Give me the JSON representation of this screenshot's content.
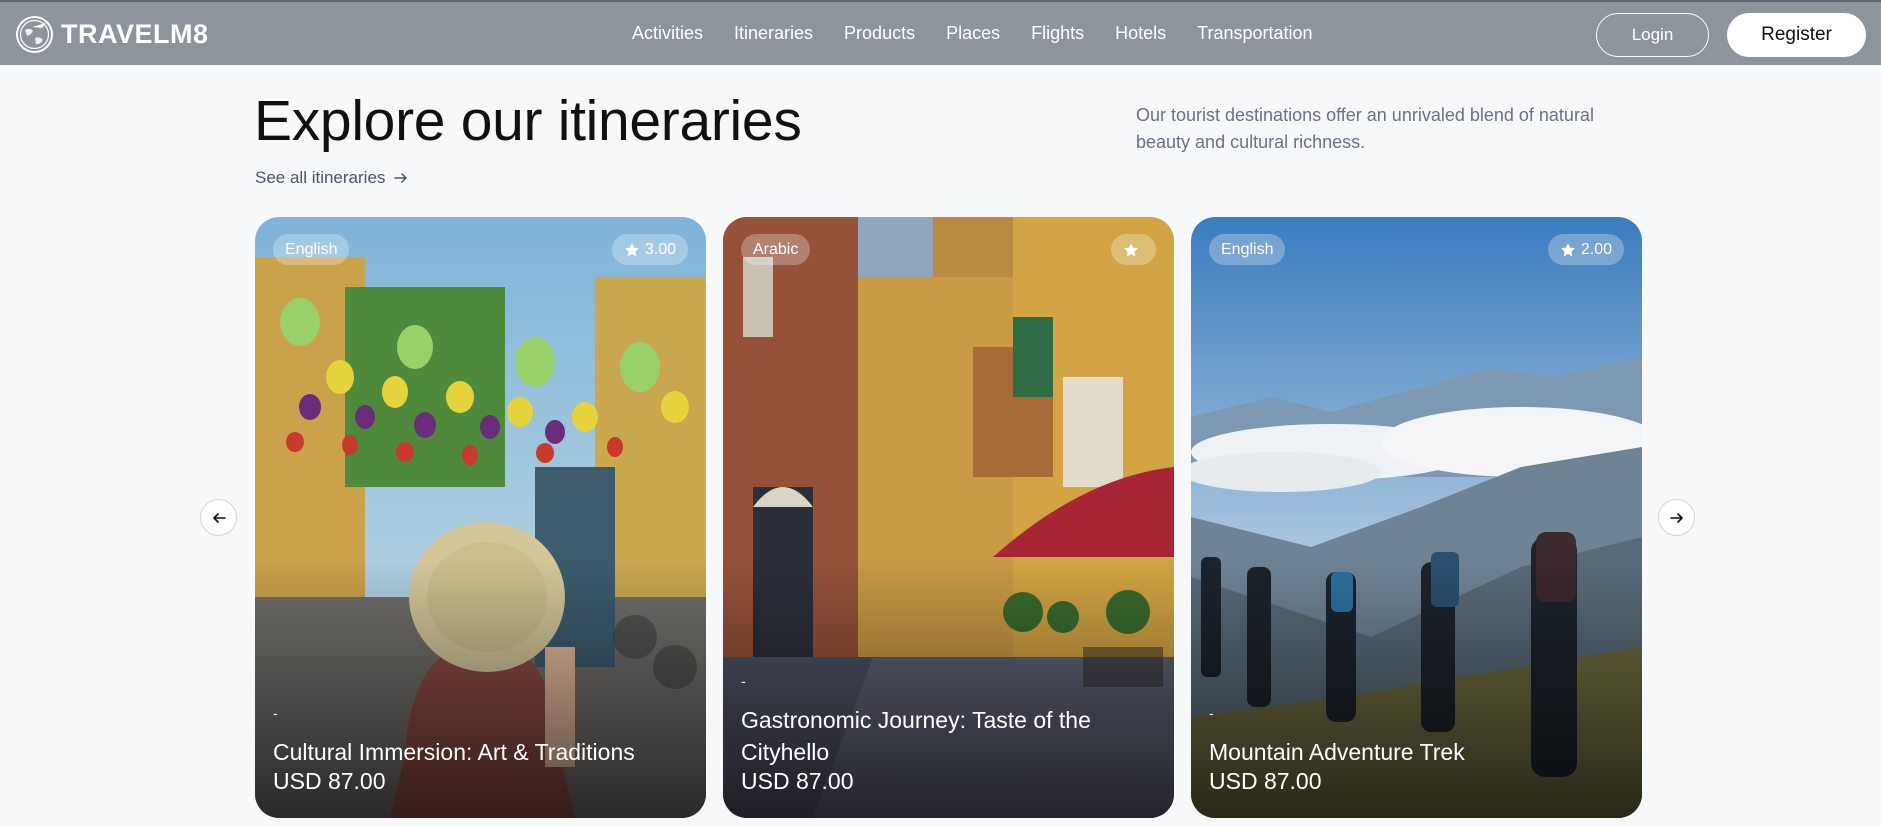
{
  "brand": {
    "name": "TRAVELM8"
  },
  "nav": {
    "links": [
      "Activities",
      "Itineraries",
      "Products",
      "Places",
      "Flights",
      "Hotels",
      "Transportation"
    ],
    "login_label": "Login",
    "register_label": "Register"
  },
  "section": {
    "title": "Explore our itineraries",
    "see_all_label": "See all itineraries",
    "subtitle": "Our tourist destinations offer an unrivaled blend of natural beauty and cultural richness."
  },
  "cards": [
    {
      "language": "English",
      "rating": "3.00",
      "dash": "-",
      "title": "Cultural Immersion: Art & Traditions",
      "price": "USD 87.00"
    },
    {
      "language": "Arabic",
      "rating": "",
      "dash": "-",
      "title": "Gastronomic Journey: Taste of the Cityhello",
      "price": "USD 87.00"
    },
    {
      "language": "English",
      "rating": "2.00",
      "dash": "-",
      "title": "Mountain Adventure Trek",
      "price": "USD 87.00"
    }
  ],
  "icons": {
    "logo": "globe-plane-icon",
    "see_all": "arrow-right-icon",
    "rating": "star-icon",
    "prev": "arrow-left-icon",
    "next": "arrow-right-icon"
  },
  "colors": {
    "navbar": "#8d949c",
    "accent_text": "#6b7280",
    "background": "#f6f8fa"
  }
}
